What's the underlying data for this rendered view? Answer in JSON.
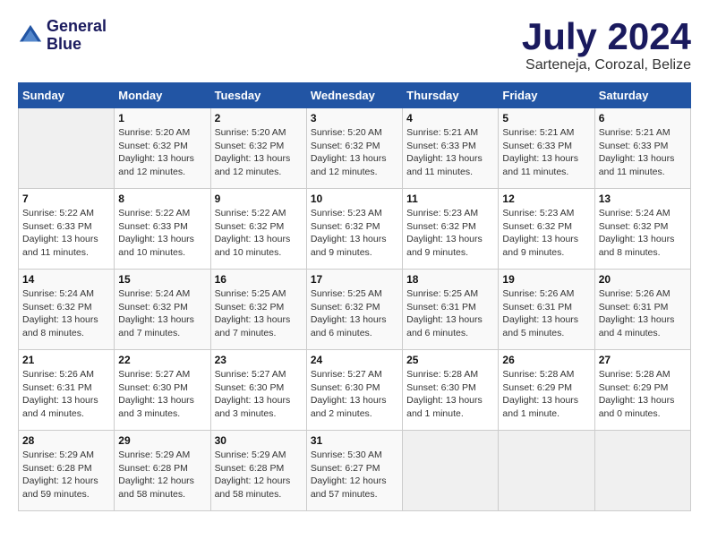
{
  "logo": {
    "line1": "General",
    "line2": "Blue"
  },
  "title": {
    "month_year": "July 2024",
    "location": "Sarteneja, Corozal, Belize"
  },
  "header": {
    "days": [
      "Sunday",
      "Monday",
      "Tuesday",
      "Wednesday",
      "Thursday",
      "Friday",
      "Saturday"
    ]
  },
  "weeks": [
    [
      {
        "day": "",
        "info": ""
      },
      {
        "day": "1",
        "info": "Sunrise: 5:20 AM\nSunset: 6:32 PM\nDaylight: 13 hours and 12 minutes."
      },
      {
        "day": "2",
        "info": "Sunrise: 5:20 AM\nSunset: 6:32 PM\nDaylight: 13 hours and 12 minutes."
      },
      {
        "day": "3",
        "info": "Sunrise: 5:20 AM\nSunset: 6:32 PM\nDaylight: 13 hours and 12 minutes."
      },
      {
        "day": "4",
        "info": "Sunrise: 5:21 AM\nSunset: 6:33 PM\nDaylight: 13 hours and 11 minutes."
      },
      {
        "day": "5",
        "info": "Sunrise: 5:21 AM\nSunset: 6:33 PM\nDaylight: 13 hours and 11 minutes."
      },
      {
        "day": "6",
        "info": "Sunrise: 5:21 AM\nSunset: 6:33 PM\nDaylight: 13 hours and 11 minutes."
      }
    ],
    [
      {
        "day": "7",
        "info": "Sunrise: 5:22 AM\nSunset: 6:33 PM\nDaylight: 13 hours and 11 minutes."
      },
      {
        "day": "8",
        "info": "Sunrise: 5:22 AM\nSunset: 6:33 PM\nDaylight: 13 hours and 10 minutes."
      },
      {
        "day": "9",
        "info": "Sunrise: 5:22 AM\nSunset: 6:32 PM\nDaylight: 13 hours and 10 minutes."
      },
      {
        "day": "10",
        "info": "Sunrise: 5:23 AM\nSunset: 6:32 PM\nDaylight: 13 hours and 9 minutes."
      },
      {
        "day": "11",
        "info": "Sunrise: 5:23 AM\nSunset: 6:32 PM\nDaylight: 13 hours and 9 minutes."
      },
      {
        "day": "12",
        "info": "Sunrise: 5:23 AM\nSunset: 6:32 PM\nDaylight: 13 hours and 9 minutes."
      },
      {
        "day": "13",
        "info": "Sunrise: 5:24 AM\nSunset: 6:32 PM\nDaylight: 13 hours and 8 minutes."
      }
    ],
    [
      {
        "day": "14",
        "info": "Sunrise: 5:24 AM\nSunset: 6:32 PM\nDaylight: 13 hours and 8 minutes."
      },
      {
        "day": "15",
        "info": "Sunrise: 5:24 AM\nSunset: 6:32 PM\nDaylight: 13 hours and 7 minutes."
      },
      {
        "day": "16",
        "info": "Sunrise: 5:25 AM\nSunset: 6:32 PM\nDaylight: 13 hours and 7 minutes."
      },
      {
        "day": "17",
        "info": "Sunrise: 5:25 AM\nSunset: 6:32 PM\nDaylight: 13 hours and 6 minutes."
      },
      {
        "day": "18",
        "info": "Sunrise: 5:25 AM\nSunset: 6:31 PM\nDaylight: 13 hours and 6 minutes."
      },
      {
        "day": "19",
        "info": "Sunrise: 5:26 AM\nSunset: 6:31 PM\nDaylight: 13 hours and 5 minutes."
      },
      {
        "day": "20",
        "info": "Sunrise: 5:26 AM\nSunset: 6:31 PM\nDaylight: 13 hours and 4 minutes."
      }
    ],
    [
      {
        "day": "21",
        "info": "Sunrise: 5:26 AM\nSunset: 6:31 PM\nDaylight: 13 hours and 4 minutes."
      },
      {
        "day": "22",
        "info": "Sunrise: 5:27 AM\nSunset: 6:30 PM\nDaylight: 13 hours and 3 minutes."
      },
      {
        "day": "23",
        "info": "Sunrise: 5:27 AM\nSunset: 6:30 PM\nDaylight: 13 hours and 3 minutes."
      },
      {
        "day": "24",
        "info": "Sunrise: 5:27 AM\nSunset: 6:30 PM\nDaylight: 13 hours and 2 minutes."
      },
      {
        "day": "25",
        "info": "Sunrise: 5:28 AM\nSunset: 6:30 PM\nDaylight: 13 hours and 1 minute."
      },
      {
        "day": "26",
        "info": "Sunrise: 5:28 AM\nSunset: 6:29 PM\nDaylight: 13 hours and 1 minute."
      },
      {
        "day": "27",
        "info": "Sunrise: 5:28 AM\nSunset: 6:29 PM\nDaylight: 13 hours and 0 minutes."
      }
    ],
    [
      {
        "day": "28",
        "info": "Sunrise: 5:29 AM\nSunset: 6:28 PM\nDaylight: 12 hours and 59 minutes."
      },
      {
        "day": "29",
        "info": "Sunrise: 5:29 AM\nSunset: 6:28 PM\nDaylight: 12 hours and 58 minutes."
      },
      {
        "day": "30",
        "info": "Sunrise: 5:29 AM\nSunset: 6:28 PM\nDaylight: 12 hours and 58 minutes."
      },
      {
        "day": "31",
        "info": "Sunrise: 5:30 AM\nSunset: 6:27 PM\nDaylight: 12 hours and 57 minutes."
      },
      {
        "day": "",
        "info": ""
      },
      {
        "day": "",
        "info": ""
      },
      {
        "day": "",
        "info": ""
      }
    ]
  ]
}
